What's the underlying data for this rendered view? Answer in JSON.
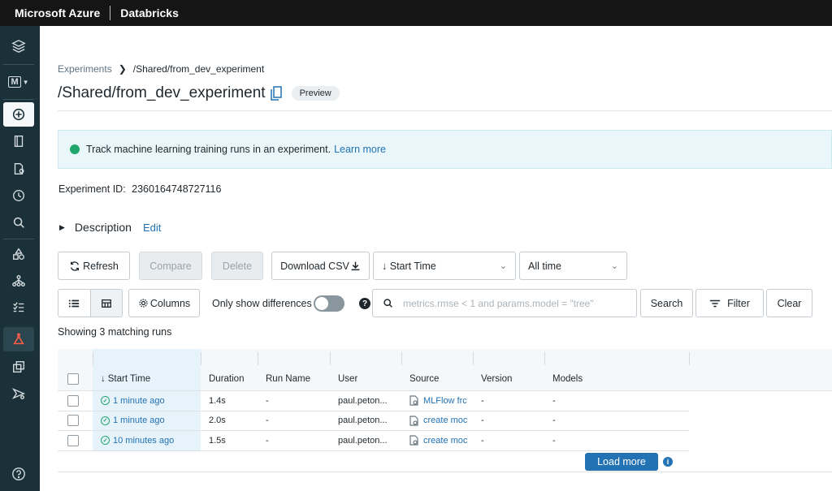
{
  "topbar": {
    "brand": "Microsoft Azure",
    "product": "Databricks"
  },
  "sidebar": {
    "items": [
      {
        "icon": "layers-icon"
      },
      {
        "icon": "workspace-m-icon",
        "label": "M"
      },
      {
        "icon": "plus-circle-icon"
      },
      {
        "icon": "notebook-icon"
      },
      {
        "icon": "data-icon"
      },
      {
        "icon": "clock-icon"
      },
      {
        "icon": "search-icon"
      },
      {
        "icon": "shapes-icon"
      },
      {
        "icon": "network-icon"
      },
      {
        "icon": "checklist-icon"
      },
      {
        "icon": "flask-icon"
      },
      {
        "icon": "models-icon"
      },
      {
        "icon": "serving-icon"
      },
      {
        "icon": "help-icon"
      }
    ]
  },
  "breadcrumb": {
    "parent": "Experiments",
    "current": "/Shared/from_dev_experiment"
  },
  "title": "/Shared/from_dev_experiment",
  "preview_tag": "Preview",
  "banner": {
    "text": "Track machine learning training runs in an experiment.",
    "link": "Learn more"
  },
  "experiment_id": {
    "label": "Experiment ID:",
    "value": "2360164748727116"
  },
  "description": {
    "label": "Description",
    "edit": "Edit"
  },
  "toolbar": {
    "refresh": "Refresh",
    "compare": "Compare",
    "delete": "Delete",
    "download_csv": "Download CSV",
    "sort_select": "Start Time",
    "time_select": "All time",
    "columns": "Columns",
    "only_diff": "Only show differences",
    "search_placeholder": "metrics.rmse < 1 and params.model = \"tree\"",
    "search": "Search",
    "filter": "Filter",
    "clear": "Clear"
  },
  "showing": "Showing 3 matching runs",
  "table": {
    "headers": [
      "Start Time",
      "Duration",
      "Run Name",
      "User",
      "Source",
      "Version",
      "Models"
    ],
    "rows": [
      {
        "start": "1 minute ago",
        "duration": "1.4s",
        "run_name": "-",
        "user": "paul.peton...",
        "source": "MLFlow frc",
        "version": "-",
        "models": "-"
      },
      {
        "start": "1 minute ago",
        "duration": "2.0s",
        "run_name": "-",
        "user": "paul.peton...",
        "source": "create moc",
        "version": "-",
        "models": "-"
      },
      {
        "start": "10 minutes ago",
        "duration": "1.5s",
        "run_name": "-",
        "user": "paul.peton...",
        "source": "create moc",
        "version": "-",
        "models": "-"
      }
    ]
  },
  "load_more": "Load more",
  "colors": {
    "accent": "#2272b4",
    "sidebar": "#1b3139",
    "topbar": "#151515",
    "success": "#21a66b"
  }
}
